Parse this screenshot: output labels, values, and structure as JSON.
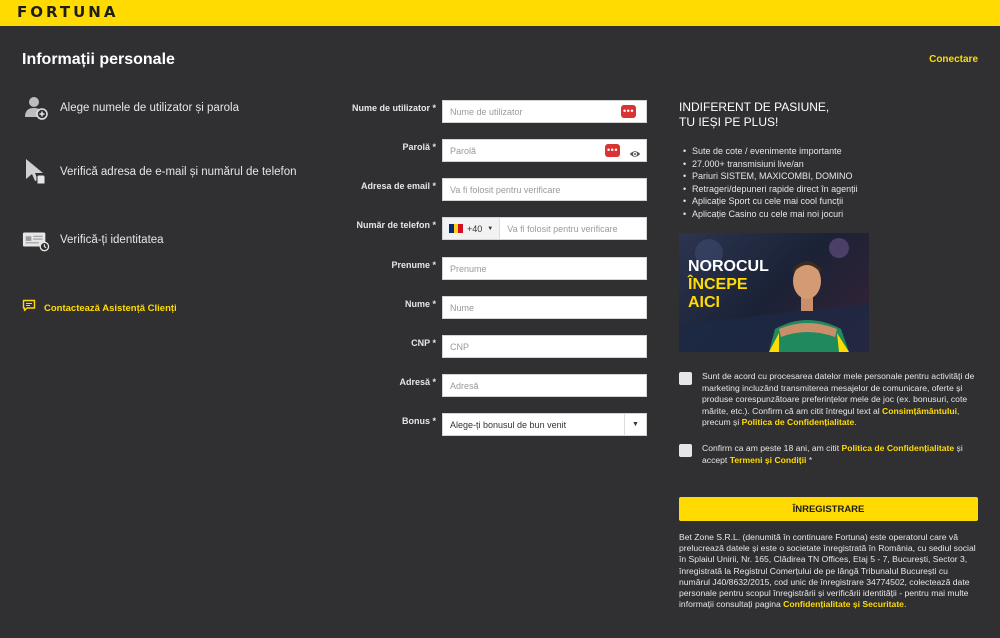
{
  "header": {
    "logo": "FORTUNA",
    "title": "Informații personale",
    "login_link": "Conectare"
  },
  "steps": [
    {
      "icon": "user-add-icon",
      "label": "Alege numele de utilizator și parola"
    },
    {
      "icon": "cursor-click-icon",
      "label": "Verifică adresa de e-mail și numărul de telefon"
    },
    {
      "icon": "id-card-icon",
      "label": "Verifică-ți identitatea"
    }
  ],
  "support": {
    "icon": "chat-icon",
    "label": "Contactează Asistență Clienți"
  },
  "form": {
    "username": {
      "label": "Nume de utilizator *",
      "placeholder": "Nume de utilizator"
    },
    "password": {
      "label": "Parolă *",
      "placeholder": "Parolă"
    },
    "email": {
      "label": "Adresa de email *",
      "placeholder": "Va fi folosit pentru verificare"
    },
    "phone": {
      "label": "Număr de telefon *",
      "prefix": "+40",
      "placeholder": "Va fi folosit pentru verificare"
    },
    "first_name": {
      "label": "Prenume *",
      "placeholder": "Prenume"
    },
    "last_name": {
      "label": "Nume *",
      "placeholder": "Nume"
    },
    "cnp": {
      "label": "CNP *",
      "placeholder": "CNP"
    },
    "address": {
      "label": "Adresă *",
      "placeholder": "Adresă"
    },
    "bonus": {
      "label": "Bonus *",
      "selected": "Alege-ți bonusul de bun venit"
    }
  },
  "promo": {
    "title_line1": "INDIFERENT DE PASIUNE,",
    "title_line2": "TU IEȘI PE PLUS!",
    "items": [
      "Sute de cote / evenimente importante",
      "27.000+ transmisiuni live/an",
      "Pariuri SISTEM, MAXICOMBI, DOMINO",
      "Retrageri/depuneri rapide direct în agenții",
      "Aplicație Sport cu cele mai cool funcții",
      "Aplicație Casino cu cele mai noi jocuri"
    ],
    "banner": {
      "line1": "NOROCUL",
      "line2": "ÎNCEPE",
      "line3": "AICI"
    }
  },
  "consent1": {
    "text": "Sunt de acord cu procesarea datelor mele personale pentru activități de marketing incluzând transmiterea mesajelor de comunicare, oferte și produse corespunzătoare preferințelor mele de joc (ex. bonusuri, cote mărite, etc.). Confirm că am citit întregul text al ",
    "link1": "Consimțământului",
    "mid": ", precum și ",
    "link2": "Politica de Confidențialitate",
    "end": "."
  },
  "consent2": {
    "text": "Confirm ca am peste 18 ani, am citit ",
    "link1": "Politica de Confidențialitate",
    "mid": " și accept ",
    "link2": "Termeni și Condiții",
    "end": " *"
  },
  "register_button": "ÎNREGISTRARE",
  "legal": {
    "text": "Bet Zone S.R.L. (denumită în continuare Fortuna) este operatorul care vă prelucrează datele și este o societate înregistrată în România, cu sediul social în Splaiul Unirii, Nr. 165, Clădirea TN Offices, Etaj 5 - 7, București, Sector 3, înregistrată la Registrul Comerțului de pe lângă Tribunalul București cu numărul J40/8632/2015, cod unic de înregistrare 34774502, colectează date personale pentru scopul înregistrării și verificării identității - pentru mai multe informații consultați pagina ",
    "link": "Confidențialitate și Securitate",
    "end": "."
  },
  "colors": {
    "brand_yellow": "#ffdb01",
    "background": "#303032",
    "password_badge": "#d93333"
  }
}
